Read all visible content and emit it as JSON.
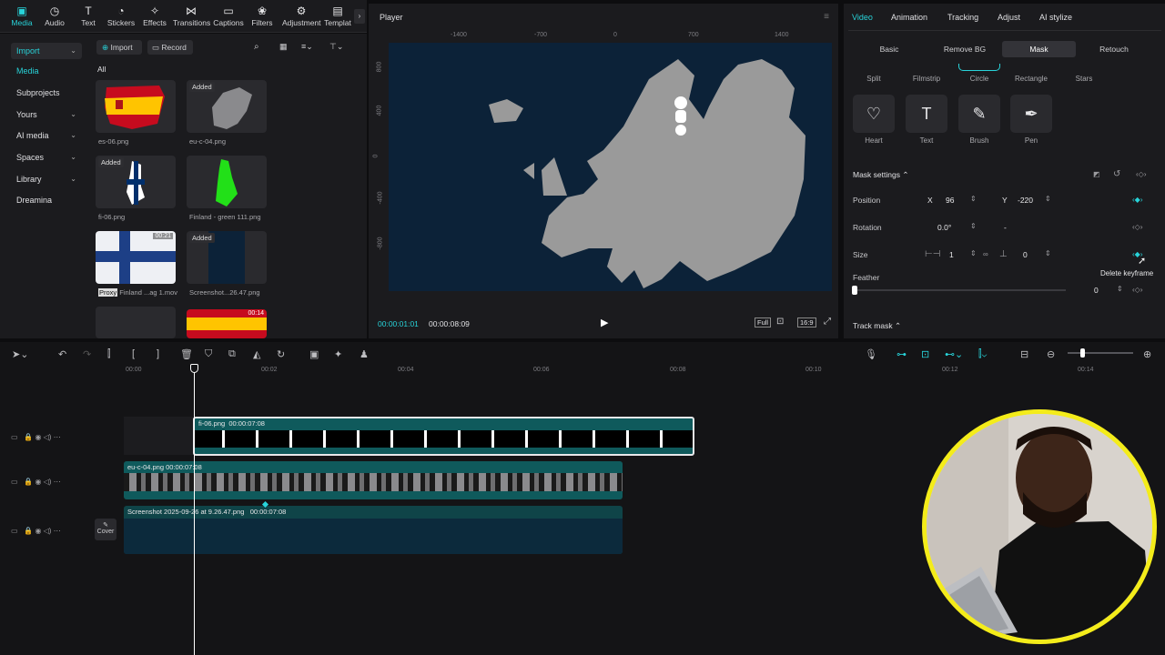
{
  "toolbar": {
    "items": [
      {
        "label": "Media",
        "icon": "media-icon"
      },
      {
        "label": "Audio",
        "icon": "audio-icon"
      },
      {
        "label": "Text",
        "icon": "text-icon"
      },
      {
        "label": "Stickers",
        "icon": "stickers-icon"
      },
      {
        "label": "Effects",
        "icon": "effects-icon"
      },
      {
        "label": "Transitions",
        "icon": "transitions-icon"
      },
      {
        "label": "Captions",
        "icon": "captions-icon"
      },
      {
        "label": "Filters",
        "icon": "filters-icon"
      },
      {
        "label": "Adjustment",
        "icon": "adjustment-icon"
      },
      {
        "label": "Templat",
        "icon": "templates-icon"
      }
    ]
  },
  "leftnav": {
    "items": [
      {
        "label": "Import"
      },
      {
        "label": "Media"
      },
      {
        "label": "Subprojects"
      },
      {
        "label": "Yours"
      },
      {
        "label": "AI media"
      },
      {
        "label": "Spaces"
      },
      {
        "label": "Library"
      },
      {
        "label": "Dreamina"
      }
    ]
  },
  "media": {
    "import_label": "Import",
    "record_label": "Record",
    "filter_label": "All",
    "items": [
      {
        "name": "es-06.png",
        "badge": ""
      },
      {
        "name": "eu-c-04.png",
        "badge": "Added"
      },
      {
        "name": "fi-06.png",
        "badge": "Added"
      },
      {
        "name": "Finland - green 111.png",
        "badge": ""
      },
      {
        "name": "Finland ...ag 1.mov",
        "badge": "",
        "proxy": "Proxy",
        "duration": "00:21"
      },
      {
        "name": "Screenshot...26.47.png",
        "badge": "Added"
      },
      {
        "name": "",
        "badge": ""
      },
      {
        "name": "",
        "badge": "",
        "duration": "00:14"
      }
    ]
  },
  "player": {
    "title": "Player",
    "ruler_top": [
      "-1400",
      "-700",
      "0",
      "700",
      "1400"
    ],
    "ruler_left": [
      "800",
      "400",
      "0",
      "-400",
      "-800"
    ],
    "current_time": "00:00:01:01",
    "total_time": "00:00:08:09",
    "full_label": "Full",
    "ratio_label": "16:9"
  },
  "right_panel": {
    "tabs": [
      "Video",
      "Animation",
      "Tracking",
      "Adjust",
      "AI stylize"
    ],
    "subtabs": [
      "Basic",
      "Remove BG",
      "Mask",
      "Retouch"
    ],
    "shapes_row1": [
      "Split",
      "Filmstrip",
      "Circle",
      "Rectangle",
      "Stars"
    ],
    "shapes_row2": [
      "Heart",
      "Text",
      "Brush",
      "Pen"
    ],
    "mask_settings_label": "Mask settings",
    "position_label": "Position",
    "pos_x_label": "X",
    "pos_x": "96",
    "pos_y_label": "Y",
    "pos_y": "-220",
    "rotation_label": "Rotation",
    "rotation_value": "0.0°",
    "rotation_dash": "-",
    "size_label": "Size",
    "size_w": "1",
    "size_h": "0",
    "tooltip": "Delete keyframe",
    "feather_label": "Feather",
    "feather_value": "0",
    "track_mask_label": "Track mask"
  },
  "timeline": {
    "ruler": [
      "00:00",
      "00:02",
      "00:04",
      "00:06",
      "00:08",
      "00:10",
      "00:12",
      "00:14"
    ],
    "clips": [
      {
        "name": "fi-06.png",
        "duration": "00:00:07:08"
      },
      {
        "name": "eu-c-04.png",
        "duration": "00:00:07:08"
      },
      {
        "name": "Screenshot 2025-09-26 at 9.26.47.png",
        "duration": "00:00:07:08"
      }
    ],
    "cover_label": "Cover"
  },
  "colors": {
    "accent": "#28d3d9",
    "clip_teal": "#0f5a5c",
    "map_ocean": "#0c2238",
    "map_land": "#9a9a9a",
    "webcam_ring": "#f4ec1a"
  }
}
